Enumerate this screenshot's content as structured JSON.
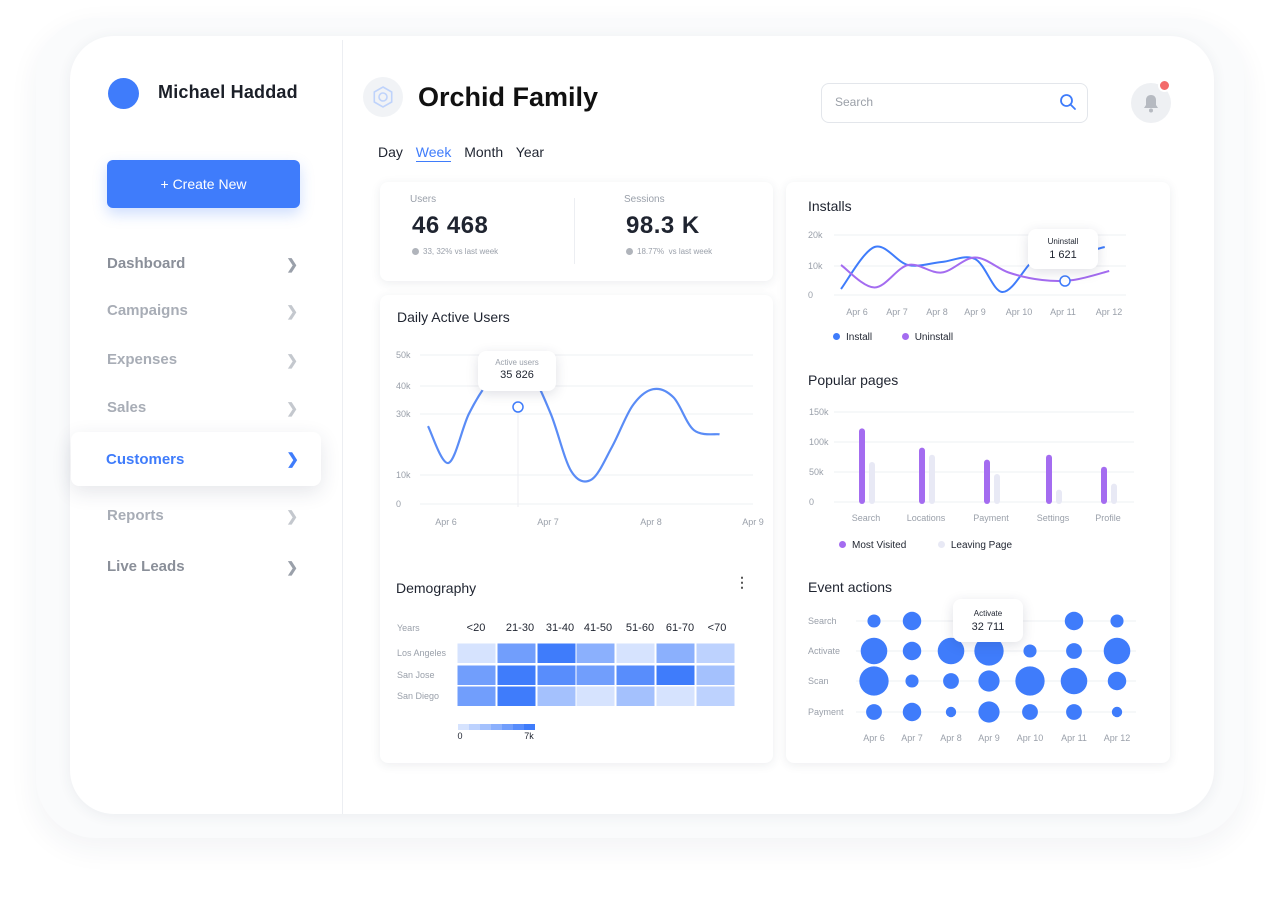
{
  "user": {
    "name": "Michael Haddad"
  },
  "sidebar": {
    "create_label": "+ Create New",
    "items": [
      {
        "label": "Dashboard",
        "active": false
      },
      {
        "label": "Campaigns",
        "active": false
      },
      {
        "label": "Expenses",
        "active": false
      },
      {
        "label": "Sales",
        "active": false
      },
      {
        "label": "Customers",
        "active": true
      },
      {
        "label": "Reports",
        "active": false
      },
      {
        "label": "Live Leads",
        "active": false
      }
    ]
  },
  "header": {
    "title": "Orchid Family",
    "search_placeholder": "Search",
    "tabs": [
      "Day",
      "Week",
      "Month",
      "Year"
    ],
    "active_tab": "Week"
  },
  "colors": {
    "accent": "#3f7cfb",
    "purple": "#a46cf0",
    "light_purple": "#e8e9f5",
    "notification": "#f36b6b"
  },
  "stats": {
    "users": {
      "label": "Users",
      "value": "46 468",
      "change": "33, 32% vs last week"
    },
    "sessions": {
      "label": "Sessions",
      "value": "98.3 K",
      "change_pct": "18.77%",
      "change_text": "vs last week"
    }
  },
  "charts": {
    "daily_active": {
      "title": "Daily Active Users",
      "tooltip_label": "Active users",
      "tooltip_value": "35 826"
    },
    "installs": {
      "title": "Installs",
      "tooltip_label": "Uninstall",
      "tooltip_value": "1 621",
      "legend": [
        "Install",
        "Uninstall"
      ]
    },
    "popular": {
      "title": "Popular pages",
      "legend": [
        "Most Visited",
        "Leaving Page"
      ]
    },
    "demography": {
      "title": "Demography",
      "row_header": "Years",
      "scale_min": "0",
      "scale_max": "7k"
    },
    "events": {
      "title": "Event actions",
      "tooltip_label": "Activate",
      "tooltip_value": "32 711"
    }
  },
  "chart_data": [
    {
      "type": "line",
      "title": "Daily Active Users",
      "x": [
        "Apr 6",
        "Apr 7",
        "Apr 8",
        "Apr 9"
      ],
      "yticks": [
        "0",
        "10k",
        "30k",
        "40k",
        "50k"
      ],
      "series": [
        {
          "values": [
            [
              0.0,
              19
            ],
            [
              0.2,
              10
            ],
            [
              0.4,
              22
            ],
            [
              0.6,
              30
            ],
            [
              0.8,
              34
            ],
            [
              1.0,
              32
            ],
            [
              1.2,
              22
            ],
            [
              1.4,
              8
            ],
            [
              1.6,
              6
            ],
            [
              1.8,
              14
            ],
            [
              2.0,
              24
            ],
            [
              2.2,
              28
            ],
            [
              2.4,
              26
            ],
            [
              2.6,
              18
            ],
            [
              2.85,
              17
            ]
          ]
        }
      ],
      "highlight": {
        "x": 0.9,
        "y": 35.826,
        "label": "Active users",
        "value": "35 826"
      }
    },
    {
      "type": "line",
      "title": "Installs",
      "x": [
        "Apr 6",
        "Apr 7",
        "Apr 8",
        "Apr 9",
        "Apr 10",
        "Apr 11",
        "Apr 12"
      ],
      "yticks": [
        "0",
        "10k",
        "20k"
      ],
      "series": [
        {
          "name": "Install",
          "values": [
            [
              0,
              2
            ],
            [
              0.75,
              16
            ],
            [
              1.5,
              10
            ],
            [
              2.25,
              11
            ],
            [
              3.0,
              12
            ],
            [
              3.6,
              1
            ],
            [
              4.2,
              10
            ],
            [
              4.6,
              18
            ],
            [
              5.2,
              14
            ],
            [
              5.9,
              16
            ]
          ]
        },
        {
          "name": "Uninstall",
          "values": [
            [
              0,
              10
            ],
            [
              0.75,
              2.5
            ],
            [
              1.5,
              10
            ],
            [
              2.25,
              7.5
            ],
            [
              3.0,
              12.5
            ],
            [
              3.75,
              7.5
            ],
            [
              4.5,
              5
            ],
            [
              5.2,
              5
            ],
            [
              6.0,
              8
            ]
          ]
        }
      ],
      "highlight": {
        "x": 5.2,
        "label": "Uninstall",
        "value": "1 621"
      }
    },
    {
      "type": "bar",
      "title": "Popular pages",
      "categories": [
        "Search",
        "Locations",
        "Payment",
        "Settings",
        "Profile"
      ],
      "yticks": [
        "0",
        "50k",
        "100k",
        "150k"
      ],
      "series": [
        {
          "name": "Most Visited",
          "values": [
            126,
            94,
            74,
            82,
            62
          ]
        },
        {
          "name": "Leaving Page",
          "values": [
            70,
            82,
            50,
            24,
            34
          ]
        }
      ]
    },
    {
      "type": "heatmap",
      "title": "Demography",
      "columns": [
        "<20",
        "21-30",
        "31-40",
        "41-50",
        "51-60",
        "61-70",
        "<70"
      ],
      "rows": [
        "Los Angeles",
        "San Jose",
        "San Diego"
      ],
      "values": [
        [
          1,
          5,
          7,
          4,
          1,
          4,
          2
        ],
        [
          5,
          7,
          6,
          5,
          6,
          7,
          3
        ],
        [
          5,
          7,
          3,
          1,
          3,
          1,
          2
        ]
      ],
      "scale": [
        "0",
        "7k"
      ]
    },
    {
      "type": "scatter",
      "title": "Event actions",
      "x": [
        "Apr 6",
        "Apr 7",
        "Apr 8",
        "Apr 9",
        "Apr 10",
        "Apr 11",
        "Apr 12"
      ],
      "rows": [
        "Search",
        "Activate",
        "Scan",
        "Payment"
      ],
      "values": [
        [
          3,
          5,
          0,
          0,
          0,
          5,
          3
        ],
        [
          8,
          5,
          8,
          9,
          3,
          4,
          8
        ],
        [
          9,
          3,
          4,
          6,
          9,
          8,
          5
        ],
        [
          4,
          5,
          2,
          6,
          4,
          4,
          2
        ]
      ],
      "highlight": {
        "row": "Activate",
        "x": "Apr 9",
        "label": "Activate",
        "value": "32 711"
      }
    }
  ]
}
